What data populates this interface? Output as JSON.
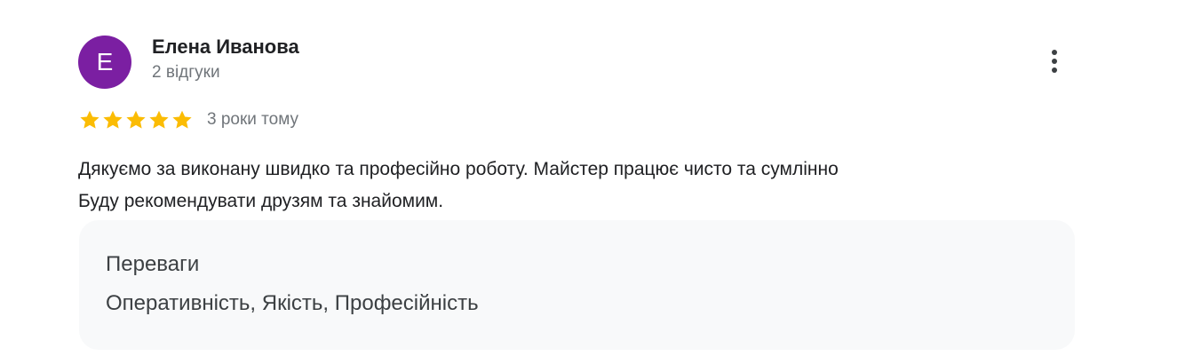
{
  "review": {
    "author": {
      "initial": "Е",
      "avatar_color": "#7b1fa2",
      "name": "Елена Иванова",
      "meta": "2 відгуки"
    },
    "more_icon": "more-vert-icon",
    "rating": {
      "stars": 5,
      "max_stars": 5,
      "star_color": "#fbbc04",
      "date": "3 роки тому"
    },
    "text_lines": [
      "Дякуємо за виконану швидко та професійно роботу. Майстер працює чисто та сумлінно",
      "Буду рекомендувати друзям та знайомим."
    ],
    "attributes": {
      "title": "Переваги",
      "value": "Оперативність, Якість, Професійність"
    }
  }
}
